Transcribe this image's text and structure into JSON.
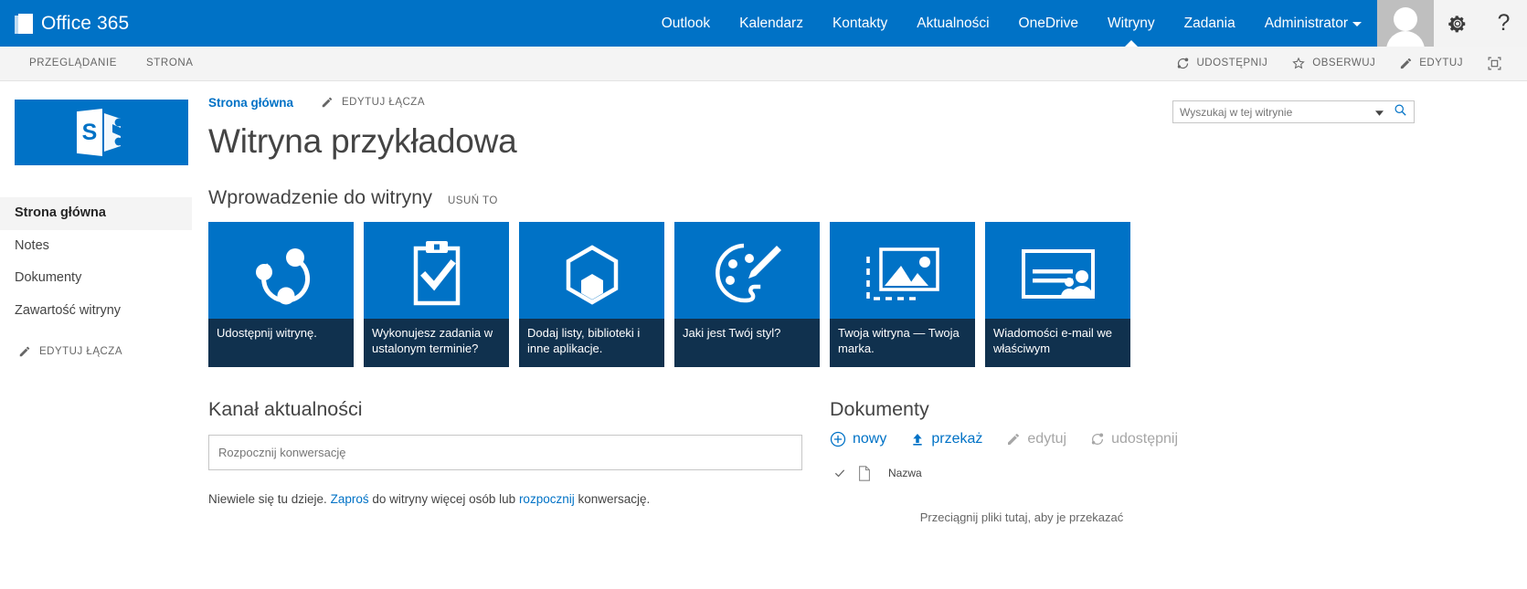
{
  "suite": {
    "brand": "Office 365",
    "nav": [
      {
        "label": "Outlook",
        "active": false
      },
      {
        "label": "Kalendarz",
        "active": false
      },
      {
        "label": "Kontakty",
        "active": false
      },
      {
        "label": "Aktualności",
        "active": false
      },
      {
        "label": "OneDrive",
        "active": false
      },
      {
        "label": "Witryny",
        "active": true
      },
      {
        "label": "Zadania",
        "active": false
      },
      {
        "label": "Administrator",
        "active": false
      }
    ],
    "help_glyph": "?",
    "accent_color": "#0072c6"
  },
  "ribbon": {
    "tabs": [
      {
        "label": "PRZEGLĄDANIE"
      },
      {
        "label": "STRONA"
      }
    ],
    "actions": [
      {
        "label": "UDOSTĘPNIJ",
        "icon": "share-icon"
      },
      {
        "label": "OBSERWUJ",
        "icon": "star-icon"
      },
      {
        "label": "EDYTUJ",
        "icon": "pencil-icon"
      },
      {
        "label": "",
        "icon": "focus-icon"
      }
    ]
  },
  "sidebar": {
    "logo_letter": "S",
    "items": [
      {
        "label": "Strona główna",
        "selected": true
      },
      {
        "label": "Notes",
        "selected": false
      },
      {
        "label": "Dokumenty",
        "selected": false
      },
      {
        "label": "Zawartość witryny",
        "selected": false
      }
    ],
    "edit_links": "EDYTUJ ŁĄCZA"
  },
  "header": {
    "breadcrumb": "Strona główna",
    "edit_links": "EDYTUJ ŁĄCZA",
    "title": "Witryna przykładowa"
  },
  "getting_started": {
    "title": "Wprowadzenie do witryny",
    "remove_label": "USUŃ TO",
    "tiles": [
      {
        "caption": "Udostępnij witrynę.",
        "icon": "share-network-icon"
      },
      {
        "caption": "Wykonujesz zadania w ustalonym terminie?",
        "icon": "clipboard-check-icon"
      },
      {
        "caption": "Dodaj listy, biblioteki i inne aplikacje.",
        "icon": "hexagon-app-icon"
      },
      {
        "caption": "Jaki jest Twój styl?",
        "icon": "palette-brush-icon"
      },
      {
        "caption": "Twoja witryna — Twoja marka.",
        "icon": "picture-icon"
      },
      {
        "caption": "Wiadomości e-mail we właściwym",
        "icon": "email-contacts-icon"
      }
    ]
  },
  "newsfeed": {
    "title": "Kanał aktualności",
    "placeholder": "Rozpocznij konwersację",
    "empty_prefix": "Niewiele się tu dzieje. ",
    "empty_link1": "Zaproś",
    "empty_mid": " do witryny więcej osób lub ",
    "empty_link2": "rozpocznij",
    "empty_suffix": " konwersację."
  },
  "documents": {
    "title": "Dokumenty",
    "commands": [
      {
        "label": "nowy",
        "icon": "plus-circle-icon",
        "disabled": false
      },
      {
        "label": "przekaż",
        "icon": "upload-icon",
        "disabled": false
      },
      {
        "label": "edytuj",
        "icon": "pencil-icon",
        "disabled": true
      },
      {
        "label": "udostępnij",
        "icon": "share-icon",
        "disabled": true
      }
    ],
    "column_name": "Nazwa",
    "drop_hint": "Przeciągnij pliki tutaj, aby je przekazać"
  },
  "search": {
    "placeholder": "Wyszukaj w tej witrynie",
    "value": ""
  }
}
